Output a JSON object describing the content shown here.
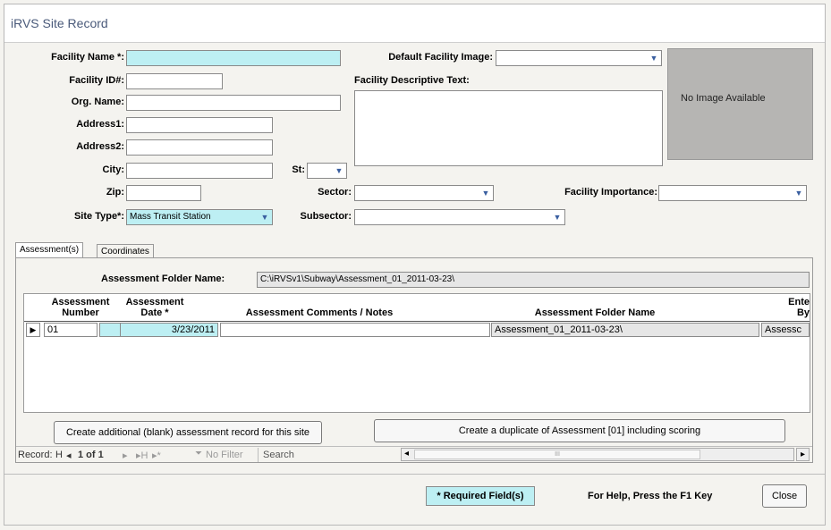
{
  "window": {
    "title": "iRVS Site Record"
  },
  "form": {
    "facility_name_label": "Facility Name *:",
    "facility_name_value": "",
    "facility_id_label": "Facility ID#:",
    "facility_id_value": "",
    "org_name_label": "Org. Name:",
    "org_name_value": "",
    "address1_label": "Address1:",
    "address1_value": "",
    "address2_label": "Address2:",
    "address2_value": "",
    "city_label": "City:",
    "city_value": "",
    "st_label": "St:",
    "st_value": "",
    "zip_label": "Zip:",
    "zip_value": "",
    "site_type_label": "Site Type*:",
    "site_type_value": "Mass Transit Station",
    "default_image_label": "Default Facility Image:",
    "default_image_value": "",
    "descriptive_text_label": "Facility Descriptive Text:",
    "descriptive_text_value": "",
    "no_image_text": "No Image Available",
    "sector_label": "Sector:",
    "sector_value": "",
    "facility_importance_label": "Facility Importance:",
    "facility_importance_value": "",
    "subsector_label": "Subsector:",
    "subsector_value": ""
  },
  "tabs": [
    {
      "label": "Assessment(s)",
      "active": true
    },
    {
      "label": "Coordinates",
      "active": false
    }
  ],
  "assessment": {
    "folder_name_label": "Assessment Folder Name:",
    "folder_name_value": "C:\\iRVSv1\\Subway\\Assessment_01_2011-03-23\\",
    "columns": {
      "number_l1": "Assessment",
      "number_l2": "Number",
      "date_l1": "Assessment",
      "date_l2": "Date *",
      "comments": "Assessment Comments / Notes",
      "folder": "Assessment Folder Name",
      "entered_l1": "Ente",
      "entered_l2": "By"
    },
    "rows": [
      {
        "number": "01",
        "date": "3/23/2011",
        "comments": "",
        "folder": "Assessment_01_2011-03-23\\",
        "entered": "Assessc"
      }
    ],
    "create_blank_button": "Create additional (blank) assessment record for this site",
    "create_duplicate_button": "Create a duplicate of Assessment [01] including scoring"
  },
  "record_nav": {
    "record_label": "Record:",
    "first": "H",
    "prev": "◂",
    "position": "1 of 1",
    "next": "▸",
    "last": "▸H",
    "new": "▸*",
    "filter_icon": "funnel-icon",
    "no_filter": "No Filter",
    "search_placeholder": "Search",
    "scroll_left": "◂",
    "scroll_mid": "III",
    "scroll_right": "▸"
  },
  "footer": {
    "required_note": "* Required Field(s)",
    "help_text": "For Help, Press the F1 Key",
    "close_button": "Close"
  },
  "colors": {
    "required_bg": "#bdeff3",
    "image_bg": "#b6b5b3",
    "title_text": "#4a5a7a"
  }
}
